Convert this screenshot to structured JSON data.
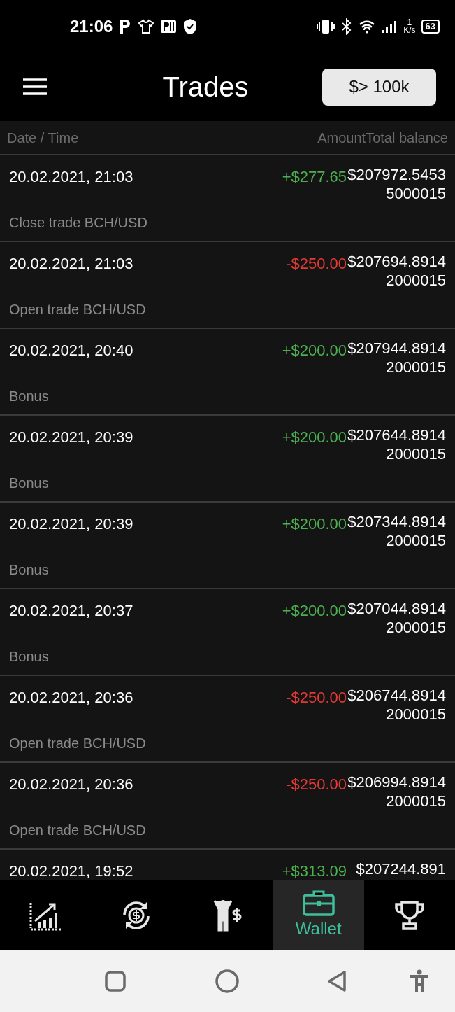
{
  "status_bar": {
    "time": "21:06",
    "speed_value": "1",
    "speed_unit": "K/s",
    "battery": "63"
  },
  "header": {
    "title": "Trades",
    "filter_button": "$> 100k"
  },
  "columns": {
    "date_time": "Date  / Time",
    "amount": "Amount",
    "balance": "Total balance"
  },
  "trades": [
    {
      "date": "20.02.2021, 21:03",
      "amount": "+$277.65",
      "kind": "credit",
      "balance": "$207972.54535000015",
      "description": "Close trade BCH/USD"
    },
    {
      "date": "20.02.2021, 21:03",
      "amount": "-$250.00",
      "kind": "debit",
      "balance": "$207694.89142000015",
      "description": "Open trade BCH/USD"
    },
    {
      "date": "20.02.2021, 20:40",
      "amount": "+$200.00",
      "kind": "credit",
      "balance": "$207944.89142000015",
      "description": "Bonus"
    },
    {
      "date": "20.02.2021, 20:39",
      "amount": "+$200.00",
      "kind": "credit",
      "balance": "$207644.89142000015",
      "description": "Bonus"
    },
    {
      "date": "20.02.2021, 20:39",
      "amount": "+$200.00",
      "kind": "credit",
      "balance": "$207344.89142000015",
      "description": "Bonus"
    },
    {
      "date": "20.02.2021, 20:37",
      "amount": "+$200.00",
      "kind": "credit",
      "balance": "$207044.89142000015",
      "description": "Bonus"
    },
    {
      "date": "20.02.2021, 20:36",
      "amount": "-$250.00",
      "kind": "debit",
      "balance": "$206744.89142000015",
      "description": "Open trade BCH/USD"
    },
    {
      "date": "20.02.2021, 20:36",
      "amount": "-$250.00",
      "kind": "debit",
      "balance": "$206994.89142000015",
      "description": "Open trade BCH/USD"
    },
    {
      "date": "20.02.2021, 19:52",
      "amount": "+$313.09",
      "kind": "credit",
      "balance": "$207244.891"
    }
  ],
  "bottom_nav": [
    {
      "kind": "chart",
      "selected": false
    },
    {
      "kind": "exchange",
      "selected": false
    },
    {
      "kind": "person",
      "selected": false
    },
    {
      "kind": "wallet",
      "label": "Wallet",
      "selected": true
    },
    {
      "kind": "trophy",
      "selected": false
    }
  ]
}
